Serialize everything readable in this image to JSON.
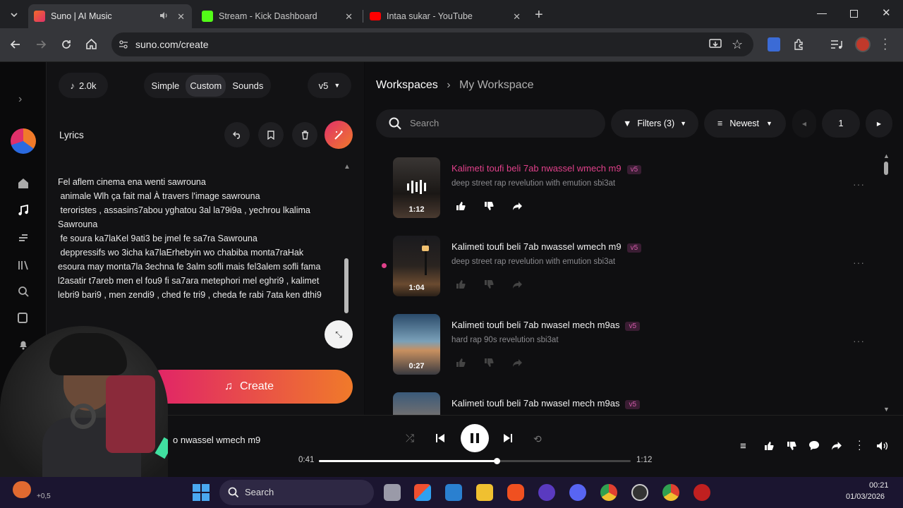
{
  "browser": {
    "tabs": [
      {
        "title": "Suno | AI Music"
      },
      {
        "title": "Stream - Kick Dashboard"
      },
      {
        "title": "Intaa sukar - YouTube"
      }
    ],
    "url": "suno.com/create"
  },
  "create": {
    "credits": "2.0k",
    "modes": [
      "Simple",
      "Custom",
      "Sounds"
    ],
    "active_mode": "Custom",
    "version": "v5",
    "lyrics_label": "Lyrics",
    "lyrics_text": "Fel aflem cinema ena wenti sawrouna\n animale Wlh ça fait mal À travers l'image sawrouna\n teroristes , assasins7abou yghatou 3al la79i9a , yechrou lkalima\nSawrouna\n fe soura ka7laKel 9ati3 be jmel fe sa7ra Sawrouna\n deppressifs wo 3icha ka7laErhebyin wo chabiba monta7raHak\nesoura may monta7la 3echna fe 3alm sofli mais fel3alem sofli fama\nl2asatir t7areb men el fou9 fi sa7ara metephori mel eghri9 , kalimet\nlebri9 bari9 , men zendi9 , ched fe tri9 , cheda fe rabi 7ata ken dthi9",
    "create_label": "Create"
  },
  "workspace": {
    "breadcrumb_root": "Workspaces",
    "breadcrumb_current": "My Workspace",
    "search_placeholder": "Search",
    "filters_label": "Filters (3)",
    "sort_label": "Newest",
    "page": "1",
    "songs": [
      {
        "title": "Kalimeti toufi beli 7ab nwassel wmech m9",
        "version": "v5",
        "desc": "deep street rap revelution with emution sbi3at",
        "duration": "1:12"
      },
      {
        "title": "Kalimeti toufi beli 7ab nwassel wmech m9",
        "version": "v5",
        "desc": "deep street rap revelution with emution sbi3at",
        "duration": "1:04"
      },
      {
        "title": "Kalimeti toufi beli 7ab nwasel mech m9as",
        "version": "v5",
        "desc": "hard rap 90s revelution sbi3at",
        "duration": "0:27"
      },
      {
        "title": "Kalimeti toufi beli 7ab nwasel mech m9as",
        "version": "v5",
        "desc": "",
        "duration": ""
      }
    ]
  },
  "player": {
    "title_visible": "o nwassel wmech m9",
    "elapsed": "0:41",
    "total": "1:12",
    "progress": 0.57
  },
  "taskbar": {
    "search_label": "Search",
    "time": "00:21",
    "date": "01/03/2026",
    "weather_temp": "+0,5"
  },
  "colors": {
    "accent_pink": "#e0408a",
    "create_gradient_start": "#e0206a",
    "create_gradient_end": "#f07a2a"
  }
}
